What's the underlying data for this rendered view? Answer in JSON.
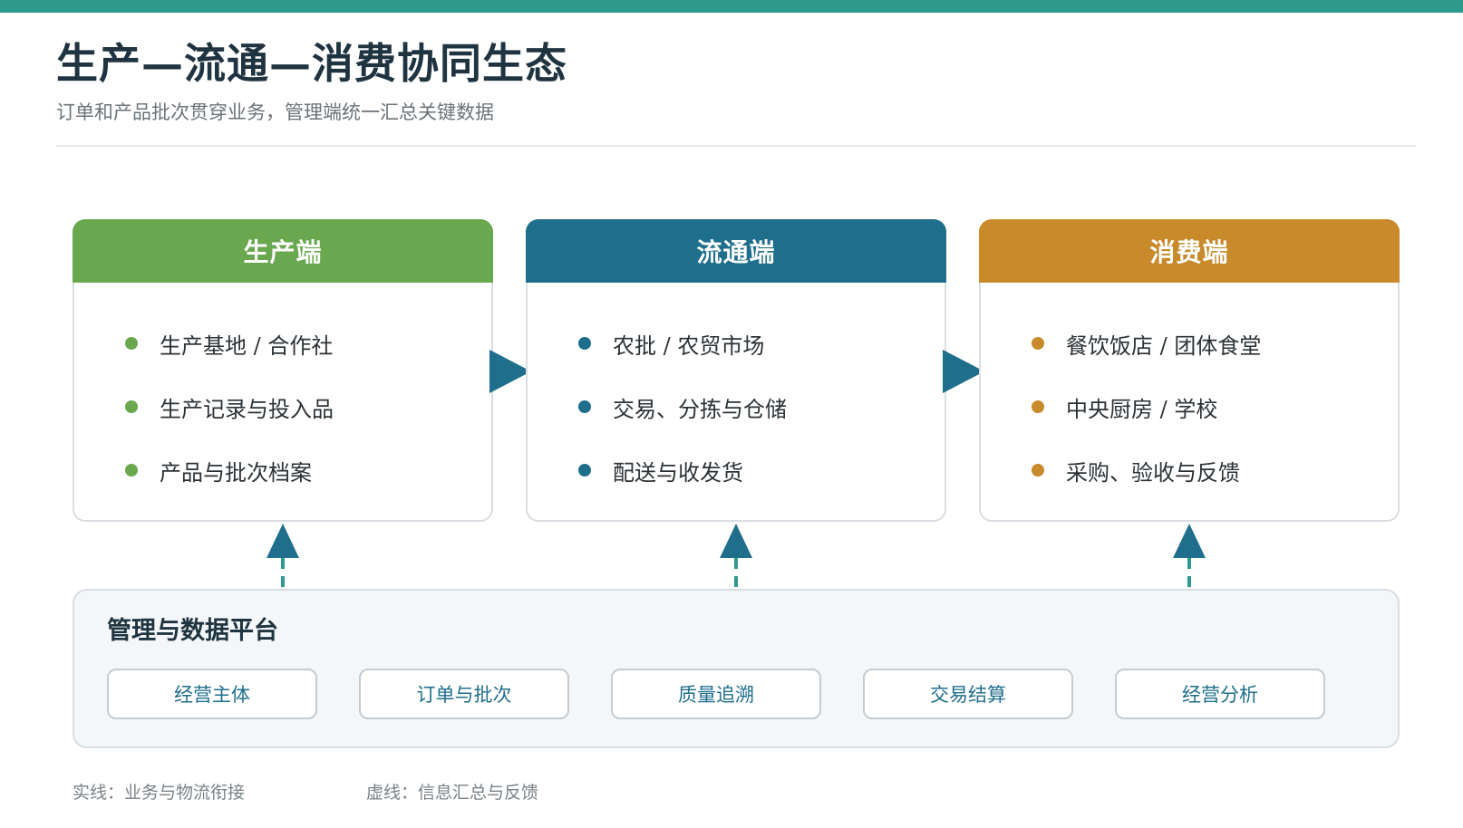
{
  "header": {
    "title": "生产—流通—消费协同生态",
    "subtitle": "订单和产品批次贯穿业务，管理端统一汇总关键数据"
  },
  "stages": [
    {
      "label": "生产端",
      "color": "#6aa84f",
      "items": [
        "生产基地 / 合作社",
        "生产记录与投入品",
        "产品与批次档案"
      ]
    },
    {
      "label": "流通端",
      "color": "#1f6e8c",
      "items": [
        "农批 / 农贸市场",
        "交易、分拣与仓储",
        "配送与收发货"
      ]
    },
    {
      "label": "消费端",
      "color": "#c88a2a",
      "items": [
        "餐饮饭店 / 团体食堂",
        "中央厨房 / 学校",
        "采购、验收与反馈"
      ]
    }
  ],
  "platform": {
    "title": "管理与数据平台",
    "modules": [
      "经营主体",
      "订单与批次",
      "质量追溯",
      "交易结算",
      "经营分析"
    ]
  },
  "legend": {
    "solid": "实线：业务与物流衔接",
    "dashed": "虚线：信息汇总与反馈"
  },
  "colors": {
    "top_bar": "#2f9a8c",
    "arrow": "#1f6e8c"
  }
}
